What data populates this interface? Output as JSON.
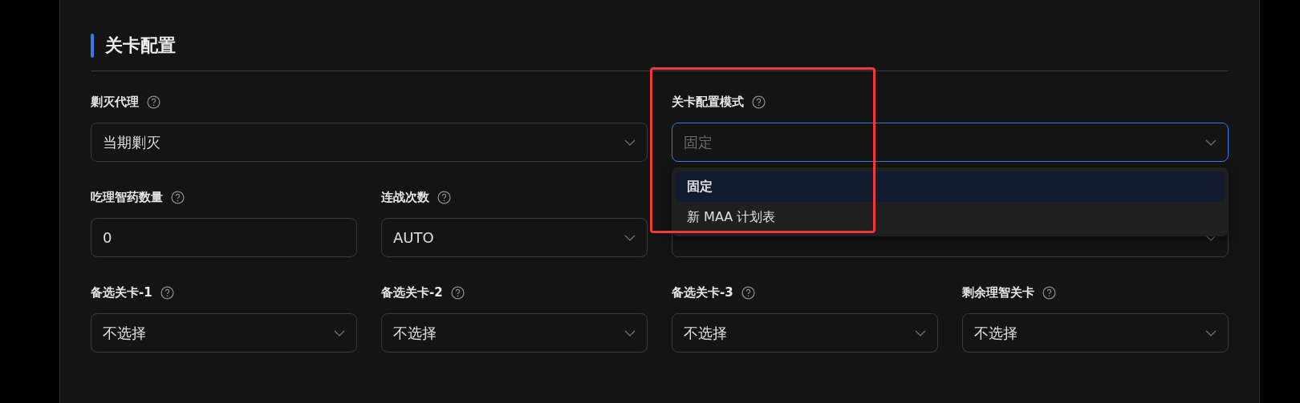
{
  "section": {
    "title": "关卡配置"
  },
  "rows": [
    [
      {
        "label": "剿灭代理",
        "kind": "select",
        "value": "当期剿灭"
      },
      {
        "label": "关卡配置模式",
        "kind": "select",
        "placeholder": "固定",
        "open": true,
        "options": [
          {
            "label": "固定",
            "selected": true
          },
          {
            "label": "新 MAA 计划表",
            "selected": false
          }
        ]
      }
    ],
    [
      {
        "label": "吃理智药数量",
        "kind": "input",
        "value": "0"
      },
      {
        "label": "连战次数",
        "kind": "select",
        "value": "AUTO"
      },
      {
        "kind": "select"
      }
    ],
    [
      {
        "label": "备选关卡-1",
        "kind": "select",
        "value": "不选择"
      },
      {
        "label": "备选关卡-2",
        "kind": "select",
        "value": "不选择"
      },
      {
        "label": "备选关卡-3",
        "kind": "select",
        "value": "不选择"
      },
      {
        "label": "剩余理智关卡",
        "kind": "select",
        "value": "不选择"
      }
    ]
  ],
  "annotation": {
    "kind": "box"
  }
}
